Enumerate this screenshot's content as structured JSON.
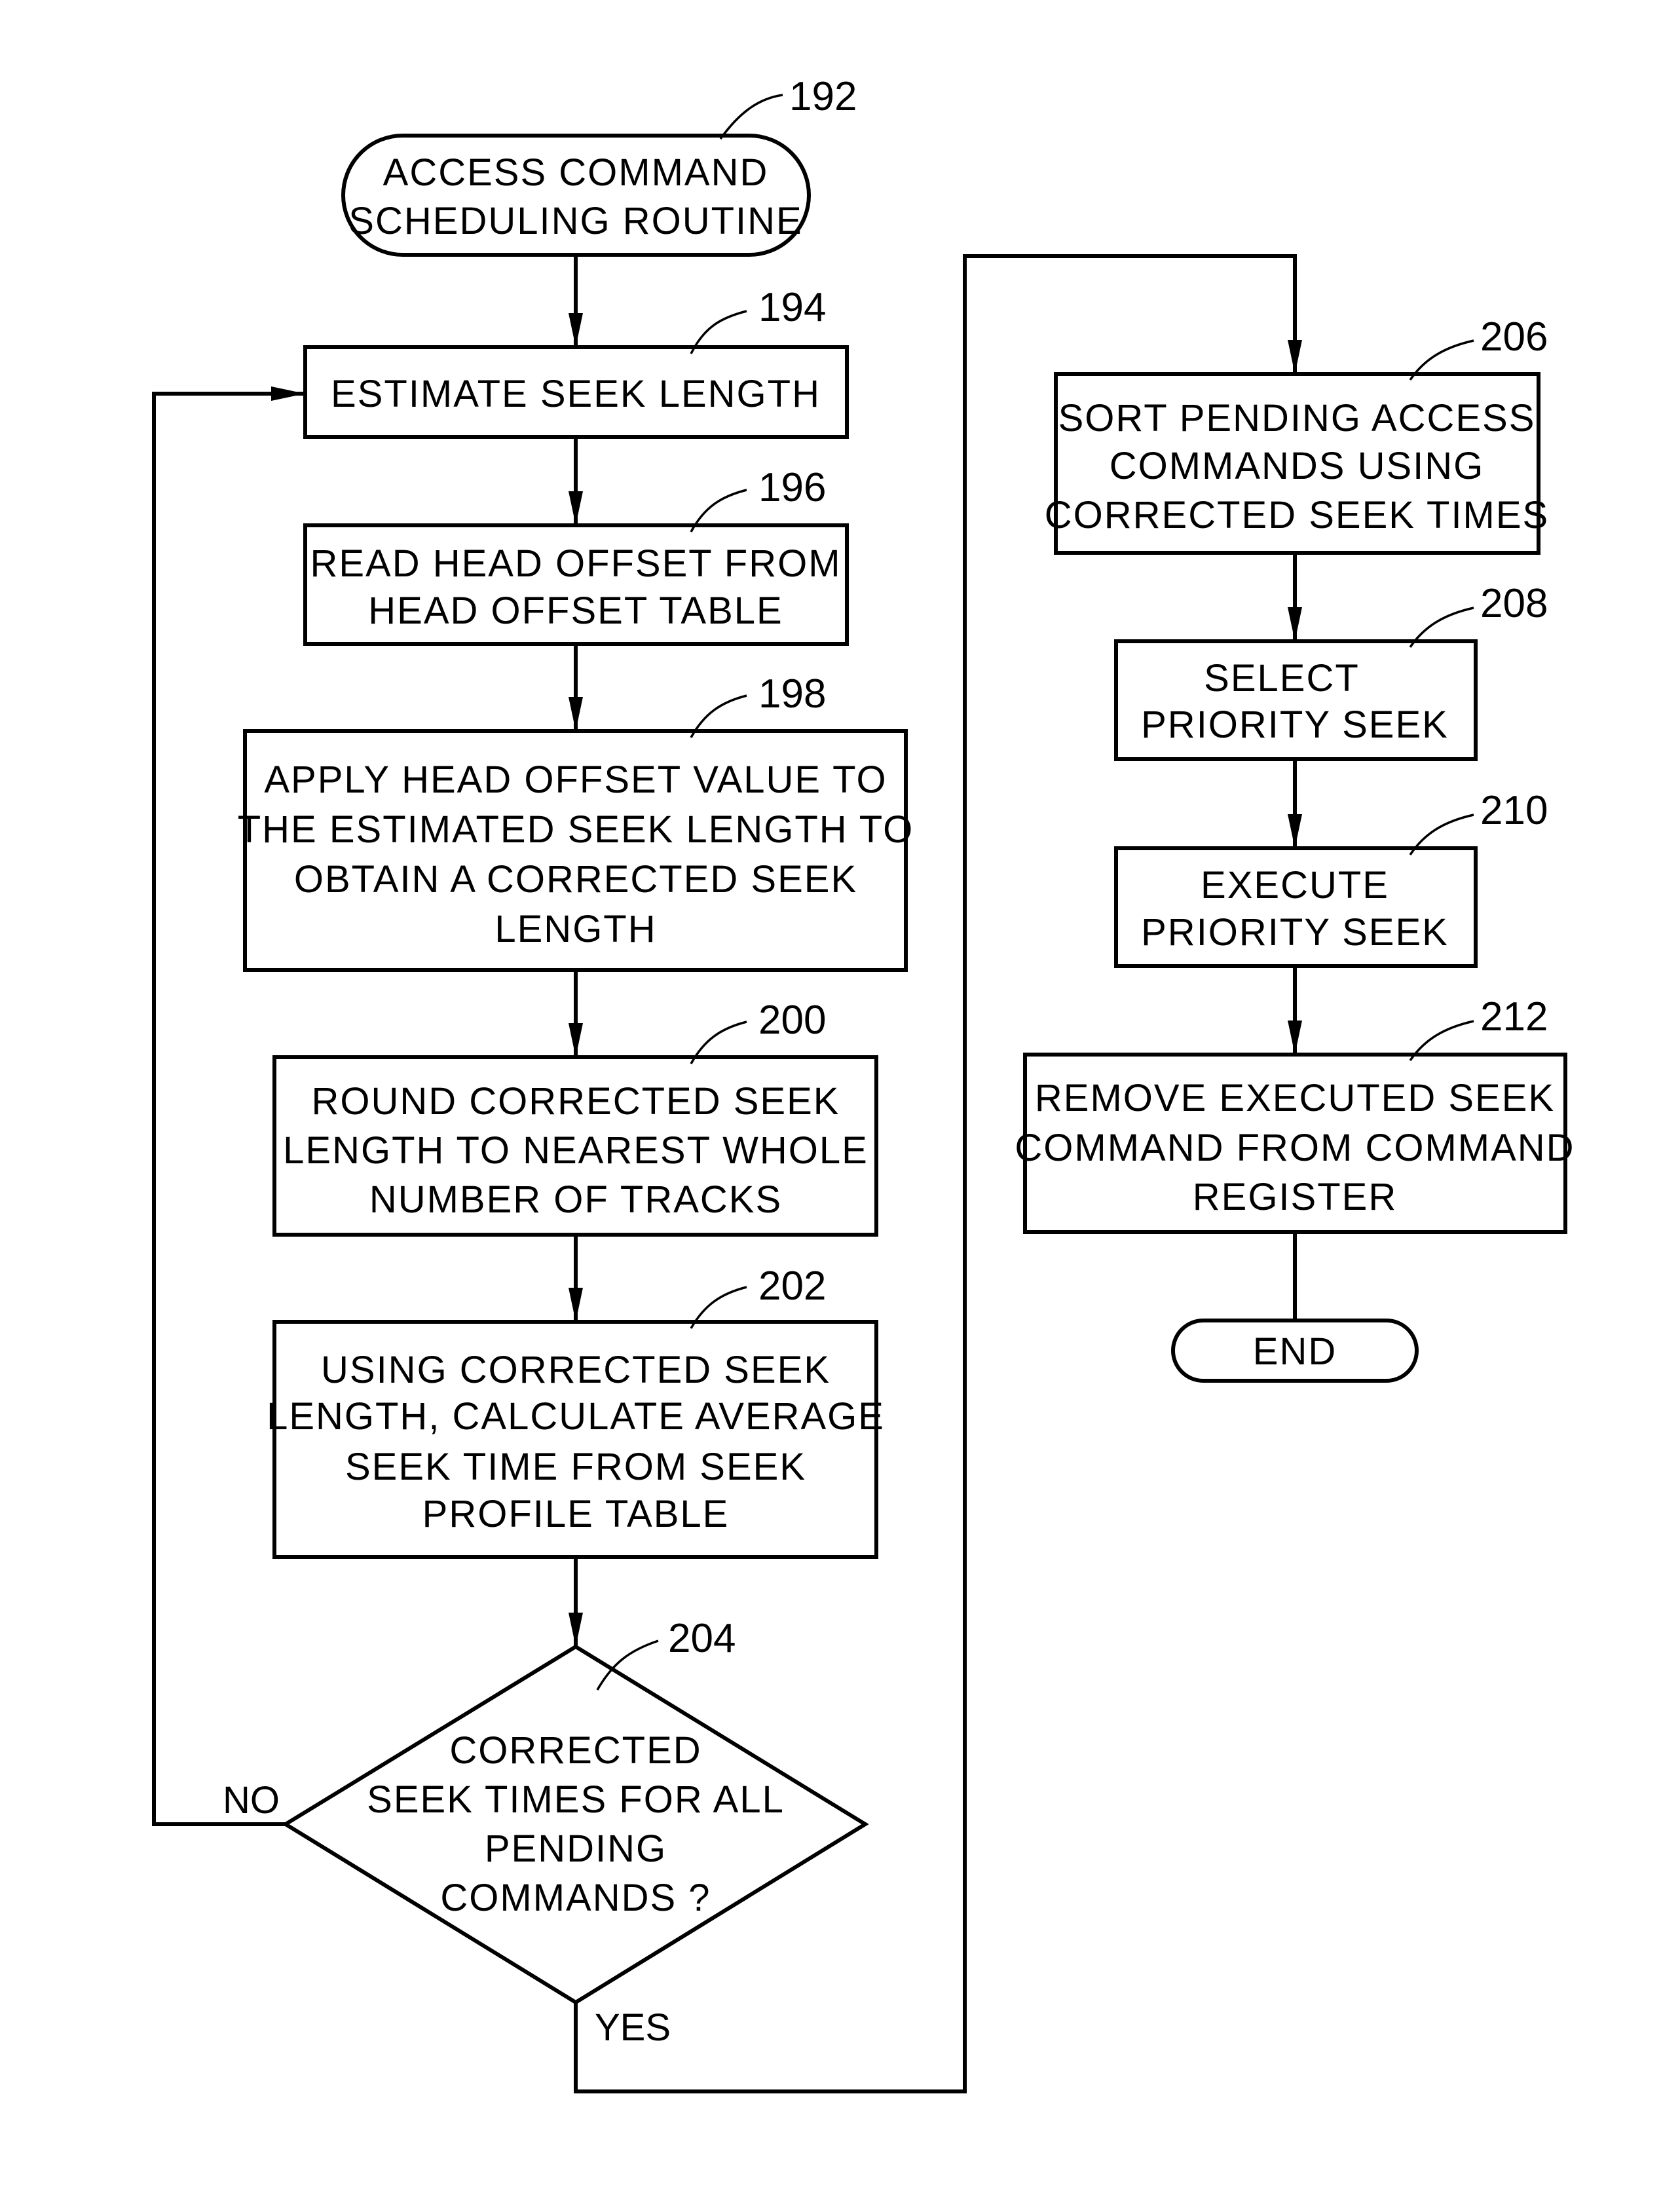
{
  "figure": {
    "title": "Access command scheduling routine flowchart"
  },
  "nodes": {
    "start": {
      "ref": "192",
      "lines": [
        "ACCESS COMMAND",
        "SCHEDULING ROUTINE"
      ]
    },
    "n194": {
      "ref": "194",
      "lines": [
        "ESTIMATE SEEK LENGTH"
      ]
    },
    "n196": {
      "ref": "196",
      "lines": [
        "READ HEAD OFFSET FROM",
        "HEAD OFFSET TABLE"
      ]
    },
    "n198": {
      "ref": "198",
      "lines": [
        "APPLY HEAD OFFSET VALUE TO",
        "THE ESTIMATED SEEK LENGTH TO",
        "OBTAIN A CORRECTED SEEK",
        "LENGTH"
      ]
    },
    "n200": {
      "ref": "200",
      "lines": [
        "ROUND CORRECTED SEEK",
        "LENGTH TO NEAREST WHOLE",
        "NUMBER OF TRACKS"
      ]
    },
    "n202": {
      "ref": "202",
      "lines": [
        "USING CORRECTED SEEK",
        "LENGTH, CALCULATE AVERAGE",
        "SEEK TIME FROM SEEK",
        "PROFILE TABLE"
      ]
    },
    "n204": {
      "ref": "204",
      "lines": [
        "CORRECTED",
        "SEEK TIMES FOR ALL",
        "PENDING",
        "COMMANDS ?"
      ],
      "no_label": "NO",
      "yes_label": "YES"
    },
    "n206": {
      "ref": "206",
      "lines": [
        "SORT PENDING ACCESS",
        "COMMANDS USING",
        "CORRECTED SEEK TIMES"
      ]
    },
    "n208": {
      "ref": "208",
      "lines": [
        "SELECT",
        "PRIORITY SEEK"
      ]
    },
    "n210": {
      "ref": "210",
      "lines": [
        "EXECUTE",
        "PRIORITY SEEK"
      ]
    },
    "n212": {
      "ref": "212",
      "lines": [
        "REMOVE EXECUTED SEEK",
        "COMMAND FROM COMMAND",
        "REGISTER"
      ]
    },
    "end": {
      "lines": [
        "END"
      ]
    }
  }
}
